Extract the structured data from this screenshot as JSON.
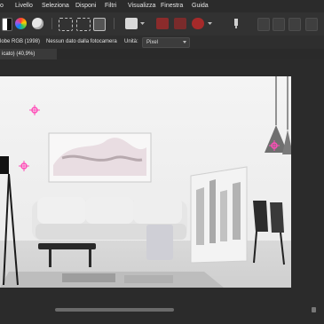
{
  "menu": {
    "items": [
      "o",
      "Livello",
      "Seleziona",
      "Disponi",
      "Filtri",
      "Visualizza",
      "Finestra",
      "Guida"
    ]
  },
  "context": {
    "color_profile": "lobe RGB (1998)",
    "camera": "Nessun dato dalla fotocamera",
    "units_label": "Unità:",
    "units_value": "Pixel"
  },
  "document_tab": {
    "title": "icato) (40,9%)"
  },
  "colors": {
    "menubar": "#2b2b2b",
    "toolbar": "#323232",
    "accent_red": "#c0392b",
    "marker_pink": "#ff4db8"
  }
}
